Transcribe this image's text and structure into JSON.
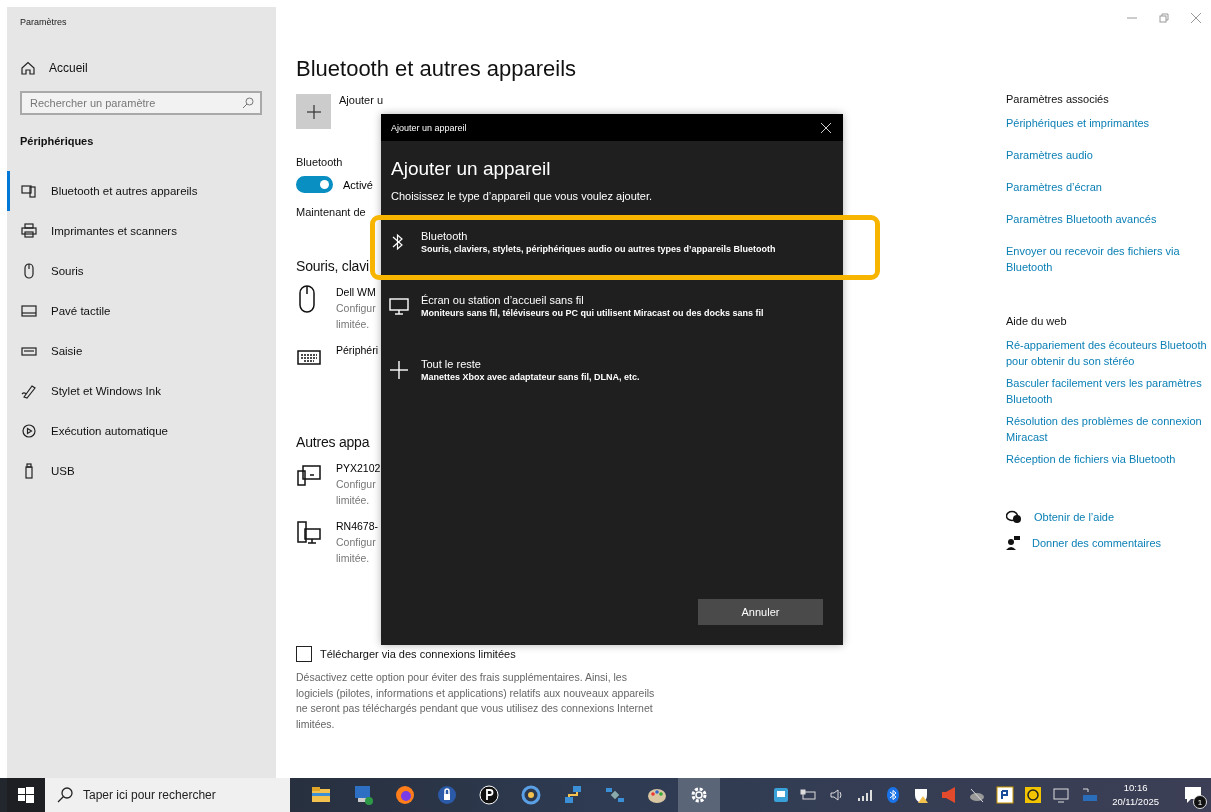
{
  "window": {
    "title": "Paramètres"
  },
  "sidebar": {
    "home": "Accueil",
    "search": {
      "placeholder": "Rechercher un paramètre"
    },
    "section": "Périphériques",
    "items": [
      {
        "label": "Bluetooth et autres appareils",
        "selected": true
      },
      {
        "label": "Imprimantes et scanners",
        "selected": false
      },
      {
        "label": "Souris",
        "selected": false
      },
      {
        "label": "Pavé tactile",
        "selected": false
      },
      {
        "label": "Saisie",
        "selected": false
      },
      {
        "label": "Stylet et Windows Ink",
        "selected": false
      },
      {
        "label": "Exécution automatique",
        "selected": false
      },
      {
        "label": "USB",
        "selected": false
      }
    ]
  },
  "main": {
    "title": "Bluetooth et autres appareils",
    "add_label": "Ajouter u",
    "bluetooth": {
      "label": "Bluetooth",
      "on": true,
      "state": "Activé"
    },
    "discoverable": "Maintenant de",
    "sections": [
      {
        "title": "Souris, clavi",
        "devices": [
          {
            "name": "Dell WM",
            "status": [
              "Configur",
              "limitée."
            ]
          },
          {
            "name": "Périphéri"
          }
        ]
      },
      {
        "title": "Autres appa",
        "devices": [
          {
            "name": "PYX2102",
            "status": [
              "Configur",
              "limitée."
            ]
          },
          {
            "name": "RN4678-",
            "status": [
              "Configur",
              "limitée."
            ]
          }
        ]
      }
    ],
    "download": {
      "label": "Télécharger via des connexions limitées",
      "checked": false
    },
    "description": "Désactivez cette option pour éviter des frais supplémentaires. Ainsi, les logiciels (pilotes, informations et applications) relatifs aux nouveaux appareils ne seront pas téléchargés pendant que vous utilisez des connexions Internet limitées."
  },
  "related": {
    "title": "Paramètres associés",
    "links": [
      "Périphériques et imprimantes",
      "Paramètres audio",
      "Paramètres d’écran",
      "Paramètres Bluetooth avancés",
      "Envoyer ou recevoir des fichiers via Bluetooth"
    ]
  },
  "web_help": {
    "title": "Aide du web",
    "links": [
      "Ré-appariement des écouteurs Bluetooth pour obtenir du son stéréo",
      "Basculer facilement vers les paramètres Bluetooth",
      "Résolution des problèmes de connexion Miracast",
      "Réception de fichiers via Bluetooth"
    ]
  },
  "support": [
    "Obtenir de l’aide",
    "Donner des commentaires"
  ],
  "dialog": {
    "title": "Ajouter un appareil",
    "heading": "Ajouter un appareil",
    "prompt": "Choisissez le type d’appareil que vous voulez ajouter.",
    "options": [
      {
        "title": "Bluetooth",
        "description": "Souris, claviers, stylets, périphériques audio ou autres types d’appareils Bluetooth",
        "highlighted": true
      },
      {
        "title": "Écran ou station d’accueil sans fil",
        "description": "Moniteurs sans fil, téléviseurs ou PC qui utilisent Miracast ou des docks sans fil",
        "highlighted": false
      },
      {
        "title": "Tout le reste",
        "description": "Manettes Xbox avec adaptateur sans fil, DLNA, etc.",
        "highlighted": false
      }
    ],
    "cancel": "Annuler"
  },
  "taskbar": {
    "search_placeholder": "Taper ici pour rechercher",
    "apps": [
      {
        "selected": false
      },
      {
        "selected": false
      },
      {
        "selected": false
      },
      {
        "selected": false
      },
      {
        "selected": false
      },
      {
        "selected": false
      },
      {
        "selected": false
      },
      {
        "selected": false
      },
      {
        "selected": false
      },
      {
        "selected": true
      }
    ],
    "time": "10:16",
    "date": "20/11/2025",
    "notifications": "1"
  }
}
